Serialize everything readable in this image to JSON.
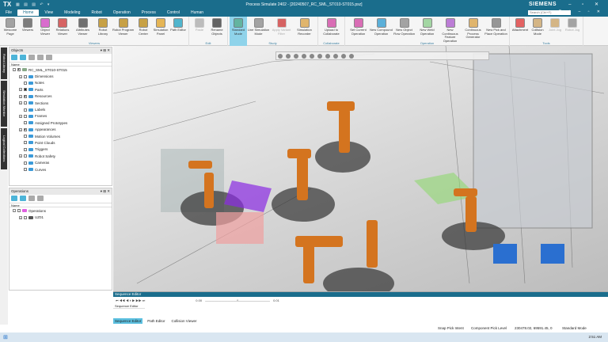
{
  "app": {
    "logo": "TX",
    "title": "Process Simulate 2402 - [20240507_RC_SML_ST010-ST015.psz]",
    "brand": "SIEMENS",
    "search_placeholder": "Search (Ctrl+F)"
  },
  "menu": [
    "File",
    "Home",
    "View",
    "Modeling",
    "Robot",
    "Operation",
    "Process",
    "Control",
    "Human"
  ],
  "ribbon": {
    "groups": [
      {
        "label": "Viewers",
        "buttons": [
          "Welcome Page",
          "Viewers",
          "Object Viewer",
          "Relations Viewer",
          "Attributes Viewer",
          "Robot Library",
          "Robot Program Viewer",
          "Robot Center",
          "Simulation Panel",
          "Path Editor"
        ]
      },
      {
        "label": "Edit",
        "buttons": [
          "Paste",
          "Rename Objects"
        ]
      },
      {
        "label": "Study",
        "buttons": [
          "Standard Mode",
          "Line Simulation Mode",
          "Apply Variant Filter",
          "Simulation Recorder"
        ]
      },
      {
        "label": "Collaborate",
        "buttons": [
          "Upload to Collaborate"
        ]
      },
      {
        "label": "Operation",
        "buttons": [
          "Set Current Operation",
          "New Compound Operation",
          "New Object Flow Operation",
          "New Weld Operation",
          "New Continuous Feature Operation",
          "Continuous Process Generator",
          "New Pick and Place Operation"
        ]
      },
      {
        "label": "Tools",
        "buttons": [
          "Attachment",
          "Collision Mode",
          "Joint Jog",
          "Robot Jog"
        ]
      }
    ]
  },
  "side_tabs": [
    "Robot Library",
    "Simulation Monitor",
    "Logical Collections"
  ],
  "objects": {
    "title": "Objects",
    "column": "Name",
    "root": "RC_SML_ST010-ST015",
    "items": [
      "Dimensions",
      "Notes",
      "Parts",
      "Resources",
      "Sections",
      "Labels",
      "Frames",
      "Assigned Prototypes",
      "Appearances",
      "Motion Volumes",
      "Point Clouds",
      "Triggers",
      "Robot Safety",
      "Cameras",
      "Curves"
    ]
  },
  "operations": {
    "title": "Operations",
    "column": "Name",
    "root": "Operations",
    "items": [
      "UZ01"
    ]
  },
  "sequence": {
    "title": "Sequence Editor",
    "time": "0.00",
    "step": "0.01",
    "column": "Sequence Editor",
    "tabs": [
      "Sequence Editor",
      "Path Editor",
      "Collision Viewer"
    ]
  },
  "status": {
    "snap": "Snap Pick Intent",
    "pick": "Component Pick Level",
    "coords": "230478.02, 69591.45, 0",
    "mode": "Standard Mode"
  },
  "taskbar": {
    "time": "2:51 AM"
  }
}
